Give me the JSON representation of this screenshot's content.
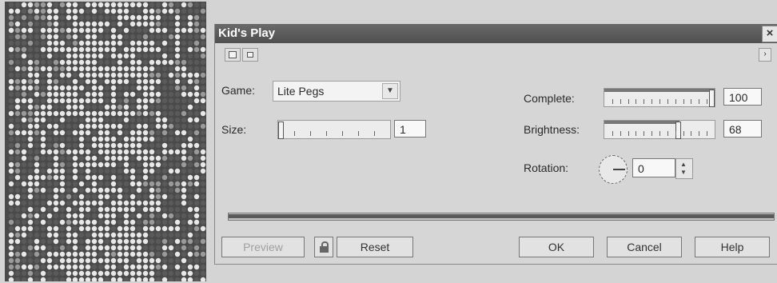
{
  "dialog": {
    "title": "Kid's Play",
    "close_glyph": "×",
    "expand_glyph": "›"
  },
  "controls": {
    "game_label": "Game:",
    "game_value": "Lite Pegs",
    "size_label": "Size:",
    "size_value": "1",
    "size_level": 0.0,
    "complete_label": "Complete:",
    "complete_value": "100",
    "complete_level": 1.0,
    "brightness_label": "Brightness:",
    "brightness_value": "68",
    "brightness_level": 0.68,
    "rotation_label": "Rotation:",
    "rotation_value": "0"
  },
  "progress": {
    "level": 1.0
  },
  "buttons": {
    "preview": "Preview",
    "reset": "Reset",
    "ok": "OK",
    "cancel": "Cancel",
    "help": "Help"
  },
  "icons": [
    "lock-icon",
    "preview-pane-icon",
    "single-pane-icon",
    "close-icon",
    "expand-icon",
    "dropdown-arrow-icon",
    "rotation-dial-icon",
    "spinner-arrows-icon"
  ],
  "colors": {
    "titlebar": "#555555",
    "dialog_bg": "#d6d6d6",
    "peg_dark": "#4a4a4a"
  }
}
